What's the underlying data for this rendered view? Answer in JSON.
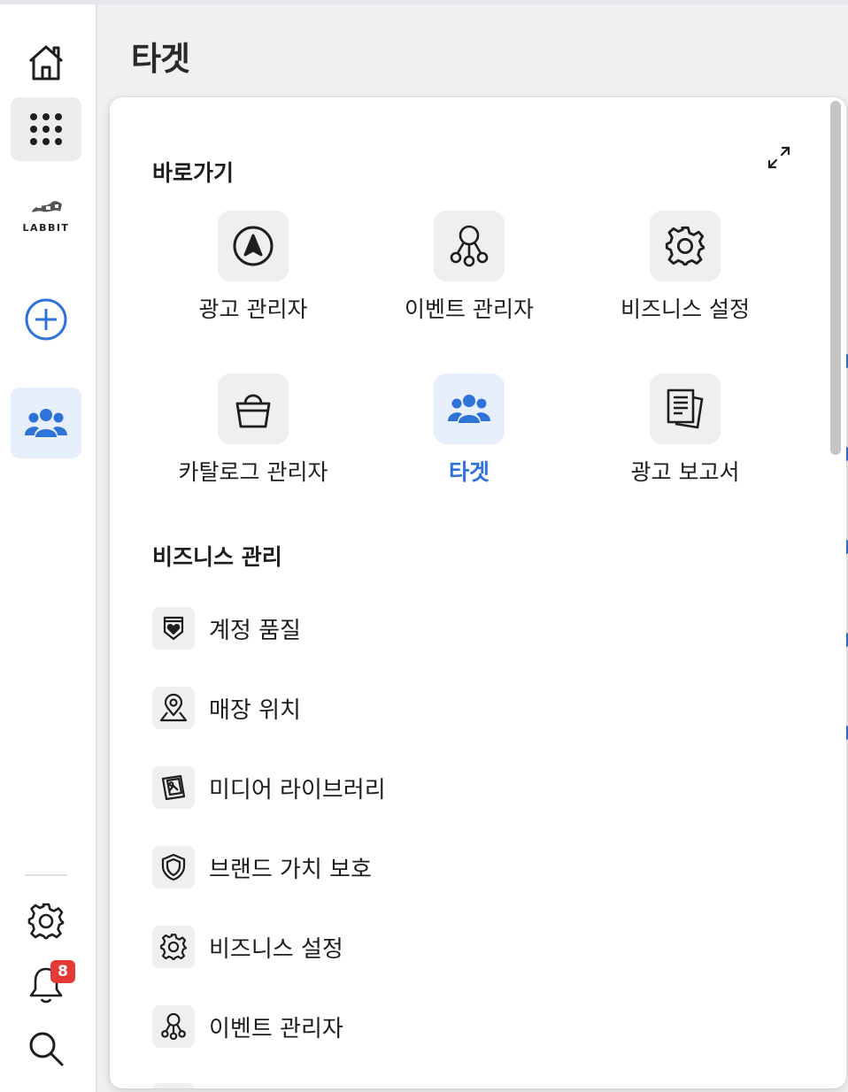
{
  "page_title": "타겟",
  "rail": {
    "logo_text": "LABBIT",
    "notification_count": "8"
  },
  "shortcuts": {
    "title": "바로가기",
    "items": [
      {
        "label": "광고 관리자",
        "icon": "navigation-arrow-icon"
      },
      {
        "label": "이벤트 관리자",
        "icon": "event-nodes-icon"
      },
      {
        "label": "비즈니스 설정",
        "icon": "gear-icon"
      },
      {
        "label": "카탈로그 관리자",
        "icon": "shopping-bag-icon"
      },
      {
        "label": "타겟",
        "icon": "people-group-icon",
        "active": true
      },
      {
        "label": "광고 보고서",
        "icon": "report-documents-icon"
      }
    ]
  },
  "business_management": {
    "title": "비즈니스 관리",
    "items": [
      {
        "label": "계정 품질",
        "icon": "badge-heart-icon"
      },
      {
        "label": "매장 위치",
        "icon": "location-pin-icon"
      },
      {
        "label": "미디어 라이브러리",
        "icon": "media-library-icon"
      },
      {
        "label": "브랜드 가치 보호",
        "icon": "shield-icon"
      },
      {
        "label": "비즈니스 설정",
        "icon": "gear-icon"
      },
      {
        "label": "이벤트 관리자",
        "icon": "event-nodes-icon"
      }
    ]
  },
  "colors": {
    "accent": "#2f73d8",
    "badge": "#e53935",
    "rail_active_bg": "#e7effc"
  }
}
